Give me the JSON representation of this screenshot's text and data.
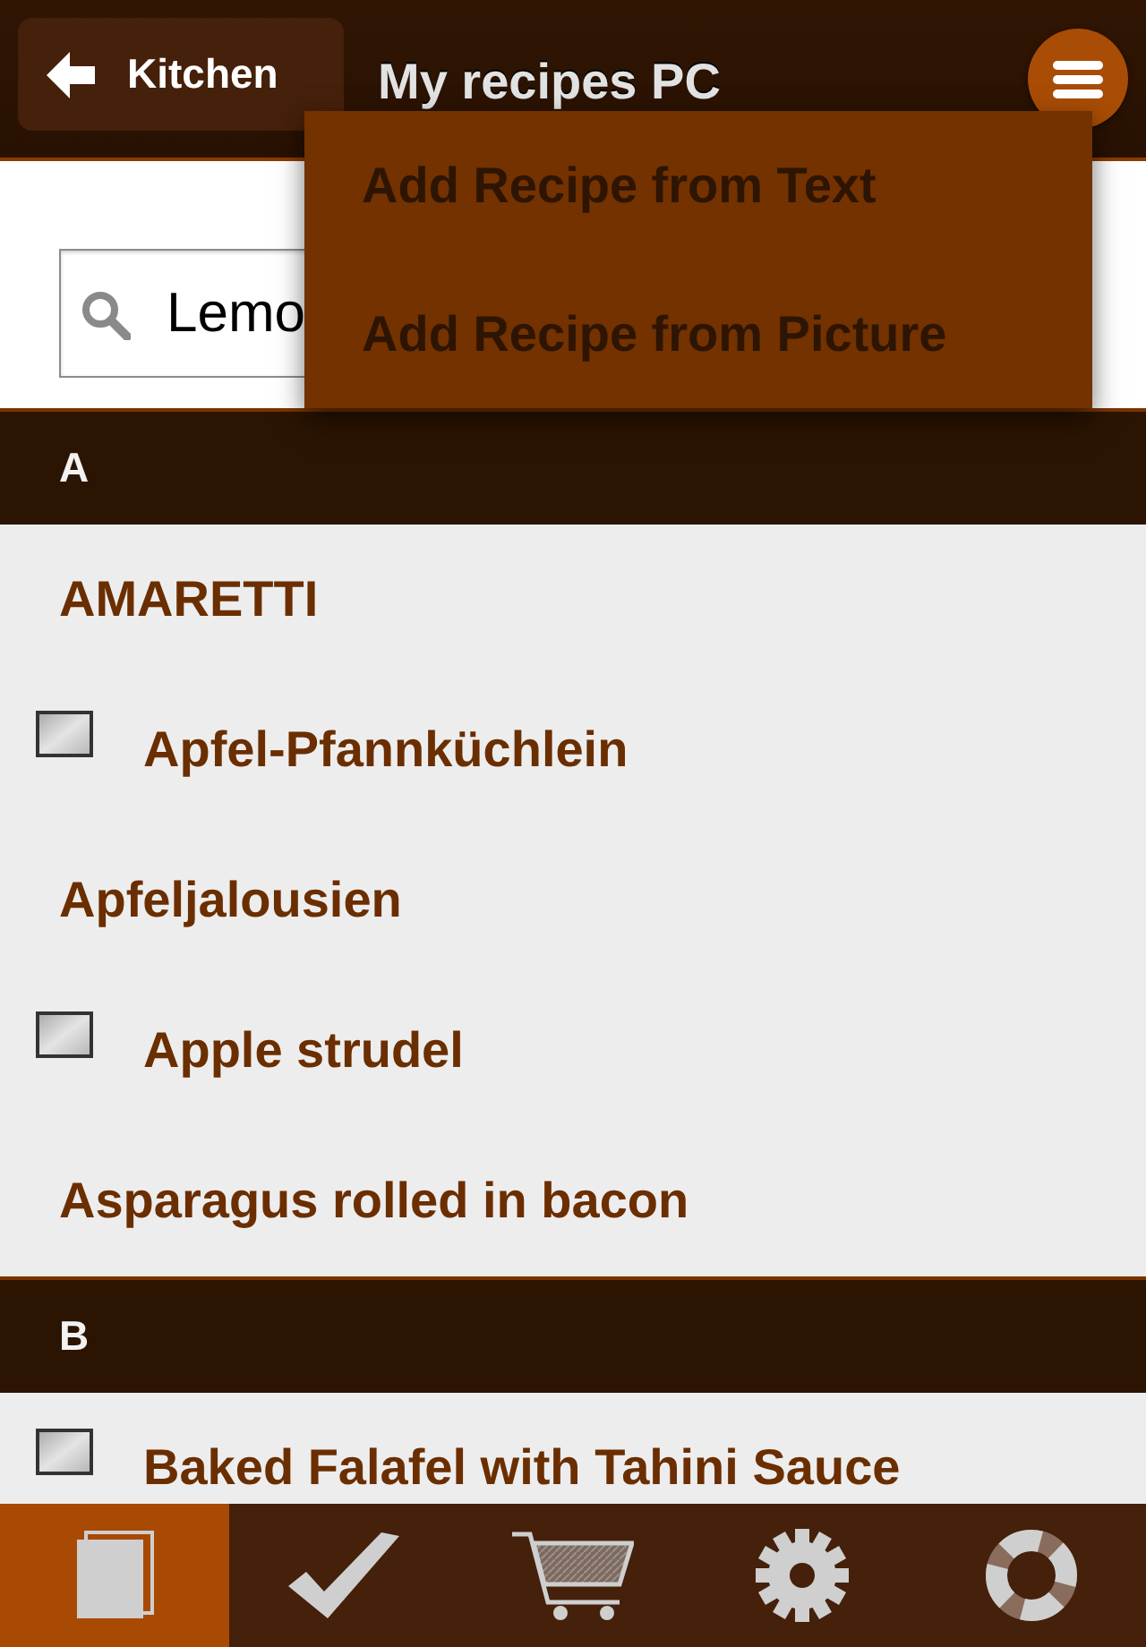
{
  "header": {
    "back_button": "Kitchen",
    "title": "My recipes PC"
  },
  "search": {
    "value": "Lemo"
  },
  "menu": {
    "items": [
      "Add Recipe from Text",
      "Add Recipe from Picture"
    ]
  },
  "sections": [
    {
      "letter": "A",
      "recipes": [
        {
          "name": "AMARETTI",
          "has_image": false
        },
        {
          "name": "Apfel-Pfannküchlein",
          "has_image": true
        },
        {
          "name": "Apfeljalousien",
          "has_image": false
        },
        {
          "name": "Apple strudel",
          "has_image": true
        },
        {
          "name": "Asparagus rolled in bacon",
          "has_image": false
        }
      ]
    },
    {
      "letter": "B",
      "recipes": [
        {
          "name": "Baked Falafel with Tahini Sauce",
          "has_image": true
        }
      ]
    }
  ],
  "tabs": [
    {
      "kind": "book",
      "selected": true
    },
    {
      "kind": "check",
      "selected": false
    },
    {
      "kind": "cart",
      "selected": false
    },
    {
      "kind": "gear",
      "selected": false
    },
    {
      "kind": "lifebuoy",
      "selected": false
    }
  ]
}
